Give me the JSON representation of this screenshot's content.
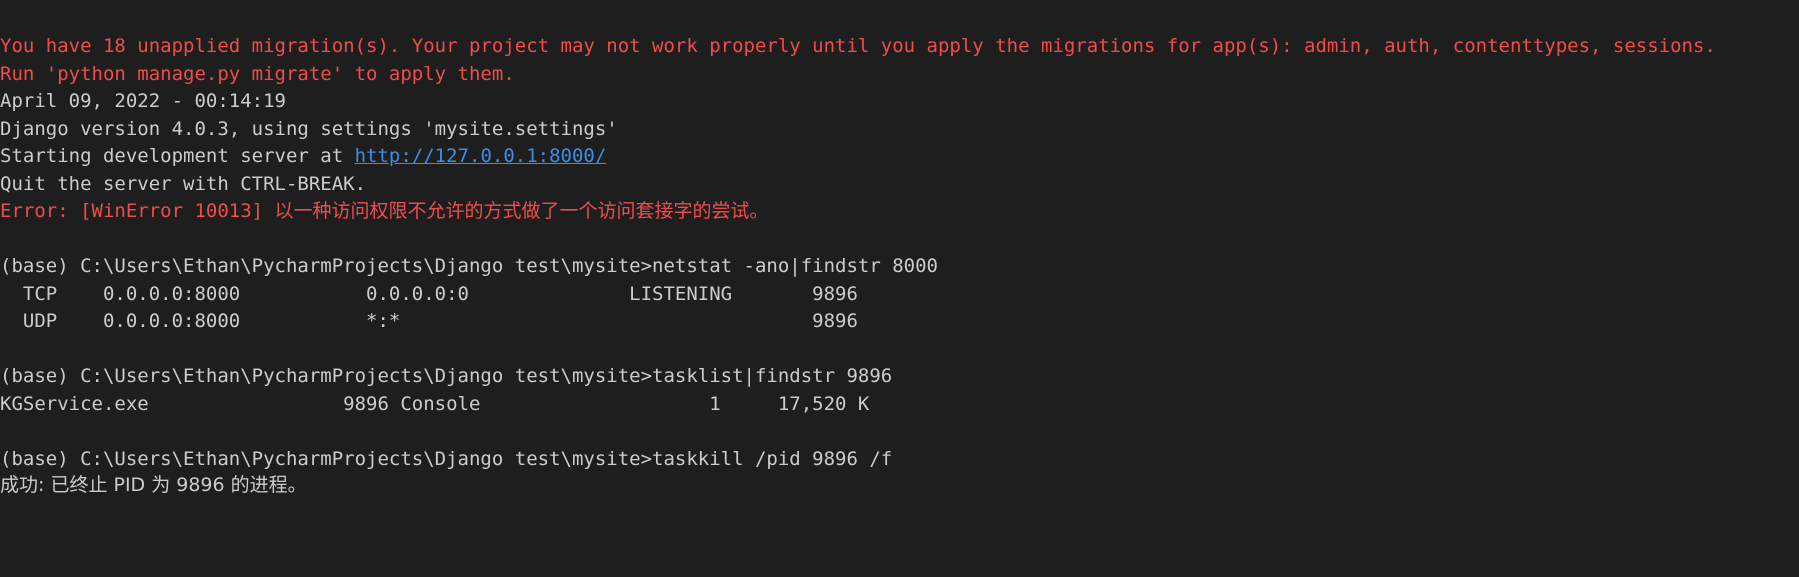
{
  "terminal": {
    "colors": {
      "background": "#1e1e1e",
      "text": "#cccccc",
      "error": "#f14c4c",
      "link": "#3b8eea"
    },
    "lines": {
      "migrate_warning_1": "You have 18 unapplied migration(s). Your project may not work properly until you apply the migrations for app(s): admin, auth, contenttypes, sessions.",
      "migrate_warning_2": "Run 'python manage.py migrate' to apply them.",
      "date": "April 09, 2022 - 00:14:19",
      "django_version": "Django version 4.0.3, using settings 'mysite.settings'",
      "starting_prefix": "Starting development server at ",
      "server_url": "http://127.0.0.1:8000/",
      "quit_hint": "Quit the server with CTRL-BREAK.",
      "error_prefix": "Error: [WinError 10013] ",
      "error_message": "以一种访问权限不允许的方式做了一个访问套接字的尝试。",
      "prompt_1": "(base) C:\\Users\\Ethan\\PycharmProjects\\Django test\\mysite>netstat -ano|findstr 8000",
      "netstat_tcp": "  TCP    0.0.0.0:8000           0.0.0.0:0              LISTENING       9896",
      "netstat_udp": "  UDP    0.0.0.0:8000           *:*                                    9896",
      "prompt_2": "(base) C:\\Users\\Ethan\\PycharmProjects\\Django test\\mysite>tasklist|findstr 9896",
      "tasklist_row": "KGService.exe                 9896 Console                    1     17,520 K",
      "prompt_3": "(base) C:\\Users\\Ethan\\PycharmProjects\\Django test\\mysite>taskkill /pid 9896 /f",
      "taskkill_result": "成功: 已终止 PID 为 9896 的进程。"
    }
  }
}
